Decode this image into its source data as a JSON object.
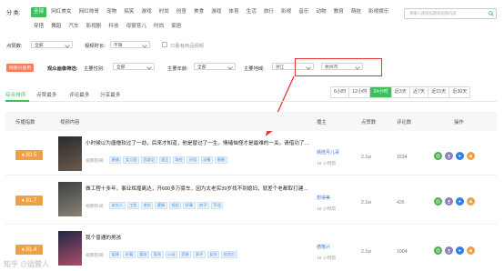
{
  "categories": {
    "label": "分 类:",
    "row1": [
      "全部",
      "网红美女",
      "网红帅哥",
      "宠物",
      "搞笑",
      "游戏",
      "时尚",
      "创意",
      "美食",
      "游戏",
      "体育",
      "生活",
      "旅行",
      "影视",
      "音乐",
      "动物",
      "教育",
      "萌娃",
      "影视娱乐"
    ],
    "row2": [
      "穿搭",
      "舞蹈",
      "汽车",
      "影视剧",
      "科技",
      "母婴育儿",
      "时尚",
      "家居"
    ],
    "active_index": 0
  },
  "search": {
    "placeholder": "请输入视频标题或视频内容"
  },
  "filters": {
    "likes_label": "点赞数:",
    "likes_value": "全部",
    "duration_label": "视频时长:",
    "duration_value": "不限",
    "only_goods_label": "只看有商品视频",
    "badge": "限新兴使用",
    "audience_label": "观众画像筛选:",
    "gender_label": "主要性别:",
    "gender_value": "全部",
    "age_label": "主要年龄:",
    "age_value": "全部",
    "region_label": "主要地域:",
    "province_value": "浙江",
    "city_value": "杭州市"
  },
  "tabs": [
    "综合排序",
    "点赞最多",
    "评论最多",
    "分享最多"
  ],
  "time_ranges": [
    "6小时",
    "12小时",
    "24小时",
    "近3天",
    "近7天",
    "近15天",
    "近30天"
  ],
  "time_active_index": 2,
  "table": {
    "headers": {
      "index": "传播指数",
      "content": "视频内容",
      "blogger": "播主",
      "likes": "点赞数",
      "comments": "评论数",
      "ops": "操作"
    },
    "hot_label": "视频热词:",
    "rows": [
      {
        "score": "83.5",
        "title": "小时候以为唐僧软过了一劫，后来才知道，他是替过了一生。情绪恼怪才是最难的一关。请借功了…",
        "tags": [
          "唐僧",
          "女儿国",
          "西游记",
          "国王",
          "取经",
          "孙悟",
          "动植",
          "唐朝"
        ],
        "blogger": "晴挂月儿哥",
        "time": "18 小时前",
        "likes": "2.1w",
        "comments": "1534"
      },
      {
        "score": "81.7",
        "title": "做工程十多年，事业辉煌离达，开600多万豪车，因为太老实39岁找不到媳妇，就差个老都取打建…",
        "tags": [
          "老实人",
          "工程",
          "老实",
          "豪情",
          "抵抗",
          "好事",
          "房子",
          "不适"
        ],
        "blogger": "想得美",
        "time": "18 小时前",
        "likes": "2.1w",
        "comments": "426"
      },
      {
        "score": "81.4",
        "title": "我个普通的男孩",
        "tags": [
          "姐妹",
          "好看",
          "喜欢",
          "男孩",
          "心动",
          "西装",
          "男子",
          "女孩",
          "优质力"
        ],
        "blogger": "德隆兴",
        "time": "18 小时前",
        "likes": "2.1w",
        "comments": "1004"
      }
    ]
  },
  "op_icons": [
    "copy-icon",
    "fan-icon",
    "play-icon",
    "star-icon"
  ],
  "colors": {
    "accent": "#3cbf5c",
    "score": "#f0a148",
    "red_highlight": "#e53935",
    "link": "#3a7bd5"
  },
  "watermark": "知乎 @运营人"
}
